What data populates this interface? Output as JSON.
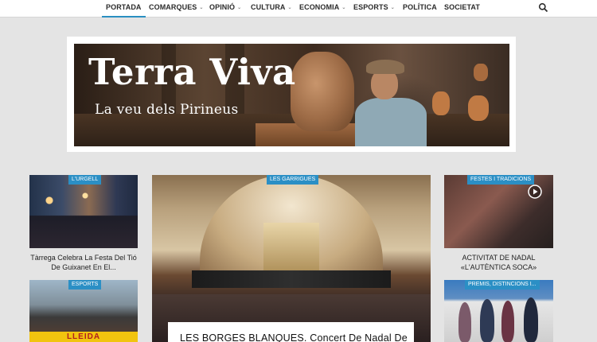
{
  "nav": {
    "items": [
      {
        "label": "PORTADA",
        "active": true,
        "dropdown": false
      },
      {
        "label": "COMARQUES",
        "dropdown": true
      },
      {
        "label": "OPINIÓ",
        "dropdown": true
      },
      {
        "label": "CULTURA",
        "dropdown": true
      },
      {
        "label": "ECONOMIA",
        "dropdown": true
      },
      {
        "label": "ESPORTS",
        "dropdown": true
      },
      {
        "label": "POLÍTICA",
        "dropdown": false
      },
      {
        "label": "SOCIETAT",
        "dropdown": false
      }
    ],
    "chevron": "⌄",
    "search_icon": "search-icon",
    "accent_color": "#2a8fc2"
  },
  "banner": {
    "title": "Terra Viva",
    "subtitle": "La veu dels Pirineus"
  },
  "cards": {
    "left_top": {
      "category": "L'URGELL",
      "title": "Tàrrega Celebra La Festa Del Tió De Guixanet En El..."
    },
    "left_bottom": {
      "category": "ESPORTS",
      "image_text": "LLEIDA"
    },
    "main": {
      "category": "LES GARRIGUES",
      "title": "LES BORGES BLANQUES. Concert De Nadal De"
    },
    "right_top": {
      "category": "FESTES I TRADICIONS",
      "title": "ACTIVITAT DE NADAL «L'AUTÈNTICA SOCA»",
      "has_video": true
    },
    "right_bottom": {
      "category": "PREMIS, DISTINCIONS I..."
    }
  },
  "colors": {
    "badge": "#2b8fc5",
    "background": "#e4e4e4"
  }
}
